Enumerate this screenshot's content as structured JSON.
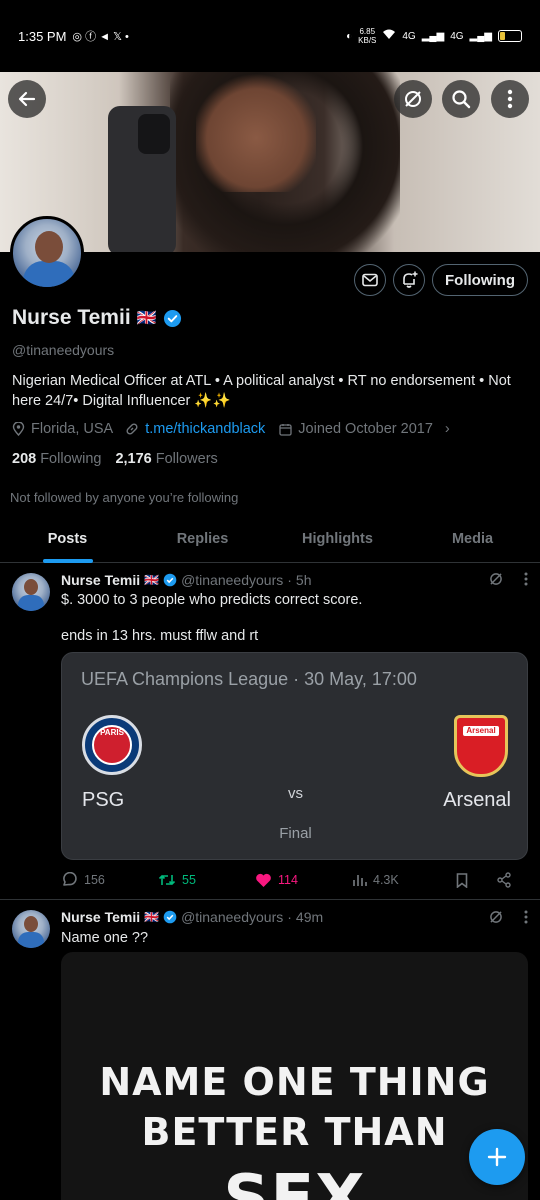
{
  "status_bar": {
    "time": "1:35 PM",
    "network_speed": "6.85",
    "network_speed_unit": "KB/S",
    "signal_1": "4G",
    "signal_2": "4G",
    "battery_percent": "26",
    "battery_level": 0.26
  },
  "profile": {
    "name": "Nurse Temii",
    "flag": "🇬🇧",
    "handle": "@tinaneedyours",
    "bio": "Nigerian  Medical Officer at ATL • A political analyst • RT no endorsement • Not here 24/7• Digital Influencer ✨✨",
    "location": "Florida, USA",
    "link": "t.me/thickandblack",
    "joined": "Joined October 2017",
    "following_count": "208",
    "following_label": "Following",
    "followers_count": "2,176",
    "followers_label": "Followers",
    "not_followed_text": "Not followed by anyone you’re following",
    "follow_button": "Following"
  },
  "tabs": [
    {
      "label": "Posts",
      "active": true
    },
    {
      "label": "Replies",
      "active": false
    },
    {
      "label": "Highlights",
      "active": false
    },
    {
      "label": "Media",
      "active": false
    }
  ],
  "posts": [
    {
      "name": "Nurse Temii",
      "flag": "🇬🇧",
      "handle": "@tinaneedyours",
      "time": "5h",
      "text_line1": "$.  3000 to 3 people who predicts correct score.",
      "text_line2": "ends in 13 hrs. must fflw and rt",
      "card": {
        "league": "UEFA Champions League · 30 May, 17:00",
        "home_team": "PSG",
        "away_team": "Arsenal",
        "vs": "vs",
        "status": "Final",
        "home_crest_text": "PARIS",
        "away_crest_text": "Arsenal"
      },
      "replies": "156",
      "reposts": "55",
      "likes": "114",
      "views": "4.3K"
    },
    {
      "name": "Nurse Temii",
      "flag": "🇬🇧",
      "handle": "@tinaneedyours",
      "time": "49m",
      "text_line1": "Name one ??",
      "image_text": [
        "NAME ONE THING",
        "BETTER THAN",
        "SEX"
      ]
    }
  ],
  "colors": {
    "accent": "#1d9bf0",
    "repost": "#00ba7c",
    "like": "#f91880",
    "muted": "#71767b",
    "background": "#000000"
  },
  "icons": {
    "back": "arrow-left-icon",
    "grok": "grok-icon",
    "search": "search-icon",
    "more": "more-vertical-icon",
    "message": "envelope-icon",
    "notify": "bell-plus-icon",
    "verified": "verified-badge-icon",
    "location": "location-pin-icon",
    "link": "link-icon",
    "calendar": "calendar-icon",
    "reply": "reply-icon",
    "repost": "repost-icon",
    "like": "heart-icon",
    "views": "views-icon",
    "bookmark": "bookmark-icon",
    "share": "share-icon",
    "compose": "plus-icon"
  }
}
